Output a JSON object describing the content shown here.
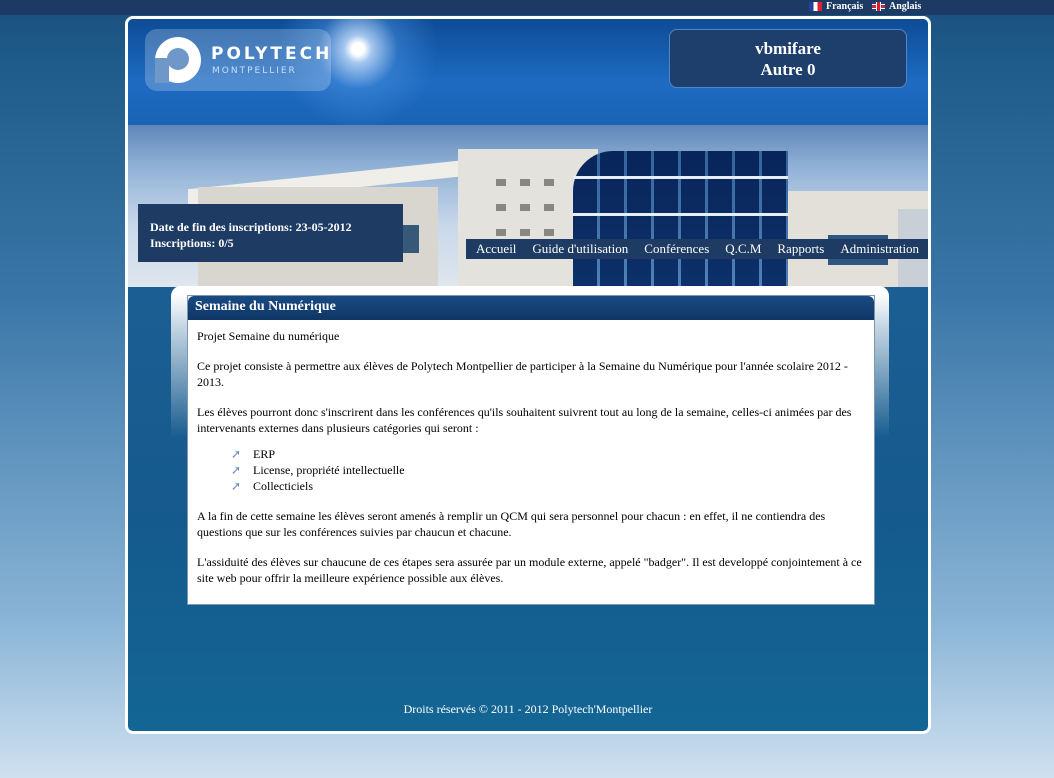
{
  "languages": [
    {
      "label": "Français",
      "flag": "fr"
    },
    {
      "label": "Anglais",
      "flag": "uk"
    }
  ],
  "logo": {
    "title": "POLYTECH",
    "subtitle": "MONTPELLIER"
  },
  "user": {
    "name": "vbmifare",
    "role": "Autre 0"
  },
  "nav": [
    "Accueil",
    "Guide d'utilisation",
    "Conférences",
    "Q.C.M",
    "Rapports",
    "Administration"
  ],
  "info": {
    "deadline": "Date de fin des inscriptions: 23-05-2012",
    "count": "Inscriptions: 0/5"
  },
  "card": {
    "title": "Semaine du Numérique",
    "paragraphs": [
      "Projet Semaine du numérique",
      "Ce projet consiste à permettre aux élèves de Polytech Montpellier de participer à la Semaine du Numérique pour l'année scolaire 2012 - 2013.",
      "Les élèves pourront donc s'inscrirent dans les conférences qu'ils souhaitent suivrent tout au long de la semaine, celles-ci animées par des intervenants externes dans plusieurs catégories qui seront :"
    ],
    "categories": [
      "ERP",
      "License, propriété intellectuelle",
      "Collecticiels"
    ],
    "after": [
      "A la fin de cette semaine les élèves seront amenés à remplir un QCM qui sera personnel pour chacun : en effet, il ne contiendra des questions que sur les conférences suivies par chaucun et chacune.",
      "L'assiduité des élèves sur chaucune de ces étapes sera assurée par un module externe, appelé \"badger\". Il est developpé conjointement à ce site web pour offrir la meilleure expérience possible aux élèves."
    ]
  },
  "footer": "Droits réservés © 2011 - 2012 Polytech'Montpellier",
  "colors": {
    "nav_bg": "#1d3b63",
    "card_title": "#0f3666",
    "accent": "#1566b0"
  }
}
